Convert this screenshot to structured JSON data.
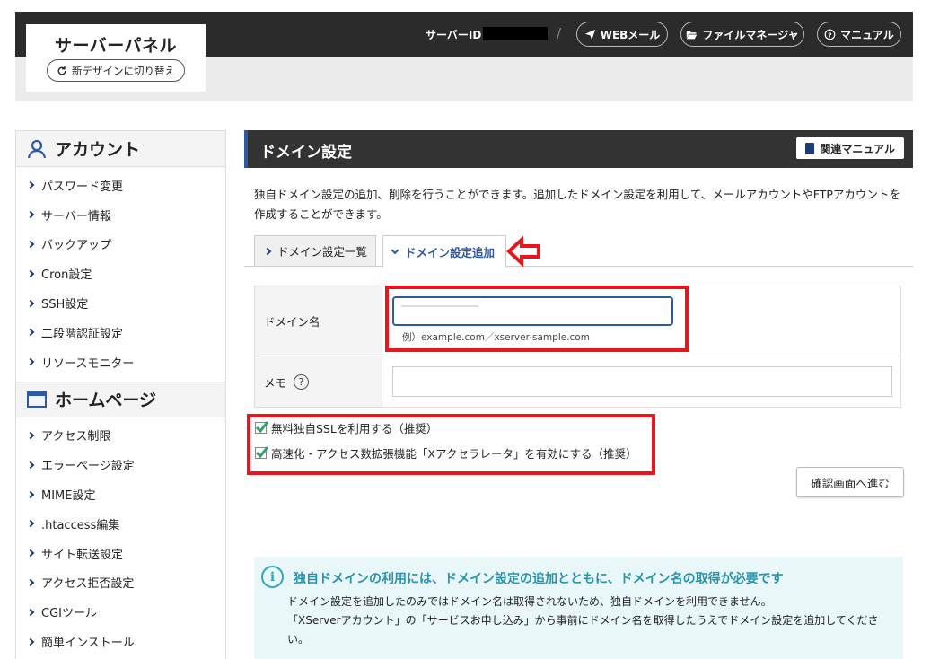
{
  "header": {
    "logo_title": "サーバーパネル",
    "switch_label": "新デザインに切り替え",
    "server_id_label": "サーバーID :",
    "separator": "/",
    "buttons": [
      {
        "label": "WEBメール",
        "icon": "paper-plane-icon"
      },
      {
        "label": "ファイルマネージャ",
        "icon": "folder-open-icon"
      },
      {
        "label": "マニュアル",
        "icon": "question-circle-icon"
      }
    ]
  },
  "sidebar": {
    "sections": [
      {
        "title": "アカウント",
        "icon": "user-icon",
        "items": [
          "パスワード変更",
          "サーバー情報",
          "バックアップ",
          "Cron設定",
          "SSH設定",
          "二段階認証設定",
          "リソースモニター"
        ]
      },
      {
        "title": "ホームページ",
        "icon": "browser-window-icon",
        "items": [
          "アクセス制限",
          "エラーページ設定",
          "MIME設定",
          ".htaccess編集",
          "サイト転送設定",
          "アクセス拒否設定",
          "CGIツール",
          "簡単インストール"
        ]
      }
    ]
  },
  "main": {
    "title": "ドメイン設定",
    "manual_button": "関連マニュアル",
    "description": "独自ドメイン設定の追加、削除を行うことができます。追加したドメイン設定を利用して、メールアカウントやFTPアカウントを作成することができます。",
    "tabs": [
      {
        "label": "ドメイン設定一覧",
        "active": false
      },
      {
        "label": "ドメイン設定追加",
        "active": true
      }
    ],
    "form": {
      "domain_label": "ドメイン名",
      "domain_value": "",
      "domain_hint": "例）example.com／xserver-sample.com",
      "memo_label": "メモ",
      "memo_help": "?",
      "memo_value": ""
    },
    "checkboxes": [
      {
        "label": "無料独自SSLを利用する（推奨）",
        "checked": true
      },
      {
        "label": "高速化・アクセス数拡張機能「Xアクセラレータ」を有効にする（推奨）",
        "checked": true
      }
    ],
    "confirm_button": "確認画面へ進む",
    "info": {
      "icon_glyph": "i",
      "title": "独自ドメインの利用には、ドメイン設定の追加とともに、ドメイン名の取得が必要です",
      "line1": "ドメイン設定を追加したのみではドメイン名は取得されないため、独自ドメインを利用できません。",
      "line2": "「XServerアカウント」の「サービスお申し込み」から事前にドメイン名を取得したうえでドメイン設定を追加してください。"
    }
  },
  "colors": {
    "header_bg": "#2b2b2b",
    "accent_blue": "#2d5aa7",
    "annotation_red": "#e8151d",
    "checkbox_green": "#2e9e6a",
    "info_bg": "#e9f7f9",
    "info_title": "#2794ad"
  }
}
